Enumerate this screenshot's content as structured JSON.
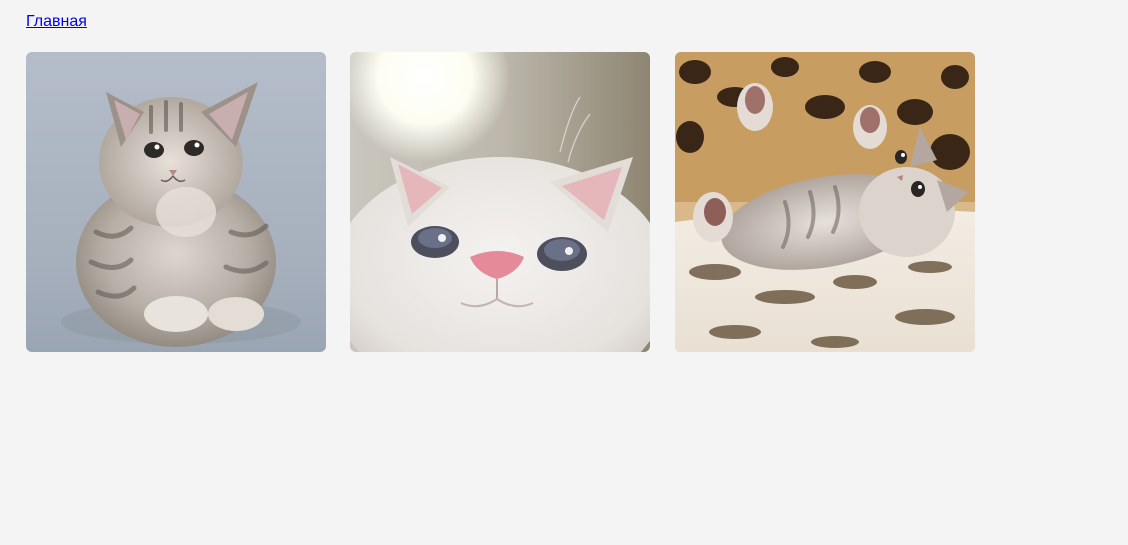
{
  "nav": {
    "home_link": "Главная"
  },
  "gallery": {
    "photos": [
      {
        "subject": "fluffy-gray-kitten-sitting"
      },
      {
        "subject": "white-kitten-looking-up"
      },
      {
        "subject": "tabby-kitten-lying-on-back"
      }
    ]
  },
  "colors": {
    "page_background": "#f4f4f4",
    "link": "#0000ee"
  }
}
